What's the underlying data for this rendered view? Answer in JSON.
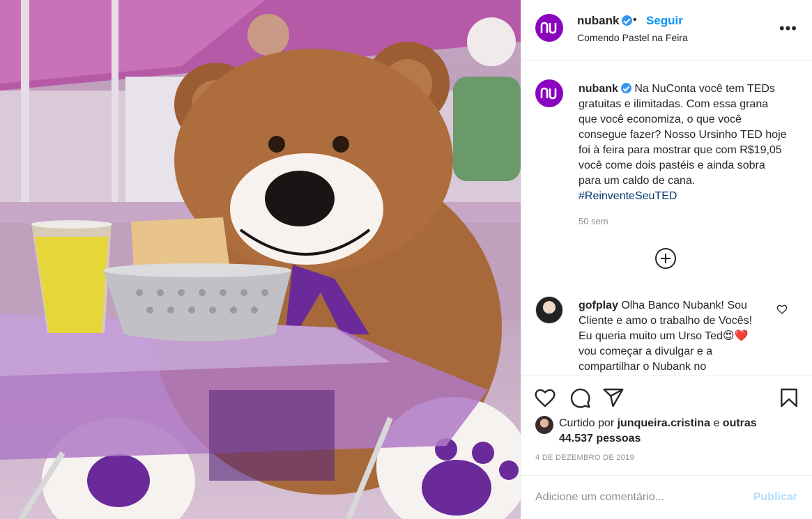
{
  "post": {
    "username": "nubank",
    "follow_label": "Seguir",
    "dot": "•",
    "location": "Comendo Pastel na Feira",
    "more_label": "•••"
  },
  "caption": {
    "username": "nubank",
    "text": "Na NuConta você tem TEDs gratuitas e ilimitadas. Com essa grana que você economiza, o que você consegue fazer? Nosso Ursinho TED hoje foi à feira para mostrar que com R$19,05 você come dois pastéis e ainda sobra para um caldo de cana.",
    "hashtag": "#ReinventeSeuTED",
    "time": "50 sem"
  },
  "comment": {
    "username": "gofplay",
    "text": "Olha Banco Nubank! Sou Cliente e amo o trabalho de Vocês! Eu queria muito um Urso Ted😍❤️ vou começar a divulgar e a compartilhar o Nubank no"
  },
  "likes": {
    "prefix": "Curtido por",
    "user": "junqueira.cristina",
    "connector": "e",
    "others": "outras 44.537 pessoas"
  },
  "date": "4 de dezembro de 2019",
  "add_comment": {
    "placeholder": "Adicione um comentário...",
    "publish_label": "Publicar"
  },
  "icons": [
    "heart-icon",
    "comment-icon",
    "share-icon",
    "bookmark-icon",
    "add-icon",
    "verified-icon",
    "more-icon"
  ],
  "colors": {
    "brand": "#8a05be",
    "link": "#0095f6",
    "hashtag": "#00376b",
    "muted": "#8e8e8e",
    "publish_disabled": "#b2dffc"
  }
}
